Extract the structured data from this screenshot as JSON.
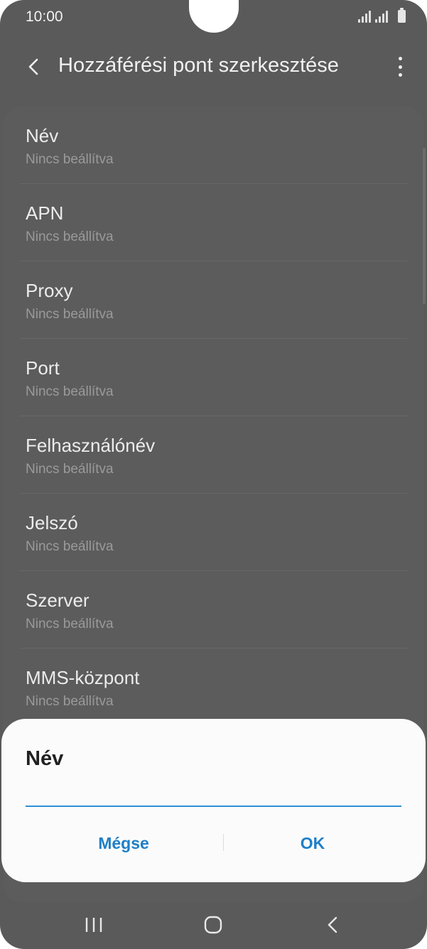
{
  "status_bar": {
    "time": "10:00"
  },
  "app_bar": {
    "title": "Hozzáférési pont szerkesztése",
    "back_icon": "chevron-left-icon",
    "more_icon": "more-vertical-icon"
  },
  "settings": {
    "items": [
      {
        "title": "Név",
        "value": "Nincs beállítva"
      },
      {
        "title": "APN",
        "value": "Nincs beállítva"
      },
      {
        "title": "Proxy",
        "value": "Nincs beállítva"
      },
      {
        "title": "Port",
        "value": "Nincs beállítva"
      },
      {
        "title": "Felhasználónév",
        "value": "Nincs beállítva"
      },
      {
        "title": "Jelszó",
        "value": "Nincs beállítva"
      },
      {
        "title": "Szerver",
        "value": "Nincs beállítva"
      },
      {
        "title": "MMS-központ",
        "value": "Nincs beállítva"
      }
    ]
  },
  "dialog": {
    "title": "Név",
    "input_value": "",
    "cancel_label": "Mégse",
    "ok_label": "OK"
  },
  "colors": {
    "accent": "#1f7fc7",
    "input_underline": "#2d8fd6",
    "dim_background": "#5a5a5a"
  }
}
